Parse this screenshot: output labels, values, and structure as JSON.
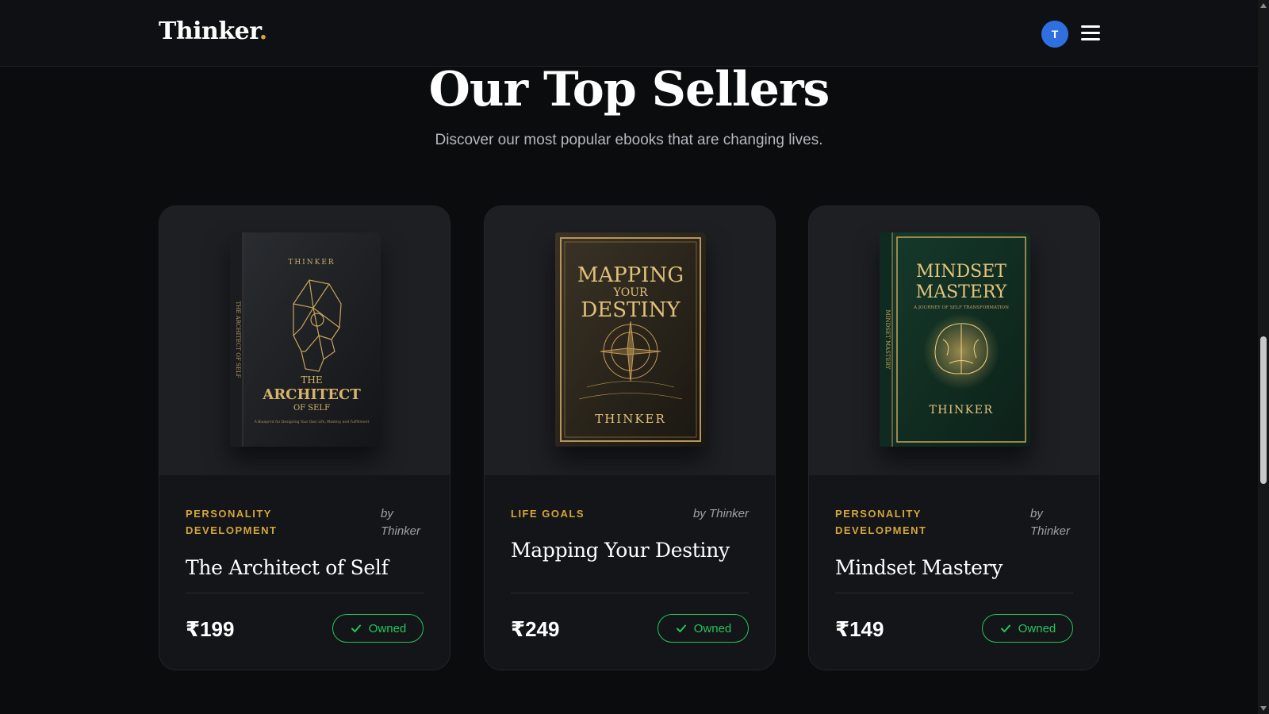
{
  "header": {
    "logo_text": "Thinker",
    "logo_dot": ".",
    "avatar_initial": "T"
  },
  "hero": {
    "title": "Our Top Sellers",
    "subtitle": "Discover our most popular ebooks that are changing lives."
  },
  "books": [
    {
      "category": "PERSONALITY DEVELOPMENT",
      "author": "by Thinker",
      "title": "The Architect of Self",
      "price": "₹199",
      "status": "Owned",
      "cover": {
        "publisher": "THINKER",
        "title_line1": "THE",
        "title_line2": "ARCHITECT",
        "title_line3": "OF SELF",
        "tagline": "A Blueprint for Designing Your Own Life, Mastery and Fulfillment",
        "spine": "THE ARCHITECT OF SELF"
      }
    },
    {
      "category": "LIFE GOALS",
      "author": "by Thinker",
      "title": "Mapping Your Destiny",
      "price": "₹249",
      "status": "Owned",
      "cover": {
        "title_line1": "MAPPING",
        "title_line2": "YOUR",
        "title_line3": "DESTINY",
        "publisher": "THINKER"
      }
    },
    {
      "category": "PERSONALITY DEVELOPMENT",
      "author": "by Thinker",
      "title": "Mindset Mastery",
      "price": "₹149",
      "status": "Owned",
      "cover": {
        "title_line1": "MINDSET",
        "title_line2": "MASTERY",
        "tagline": "A JOURNEY OF SELF TRANSFORMATION",
        "publisher": "THINKER",
        "spine": "MINDSET MASTERY"
      }
    }
  ],
  "colors": {
    "accent": "#d4a53a",
    "owned": "#22c55e",
    "avatar": "#2f6fe0",
    "background": "#0b0c0e",
    "card": "#16171a"
  }
}
